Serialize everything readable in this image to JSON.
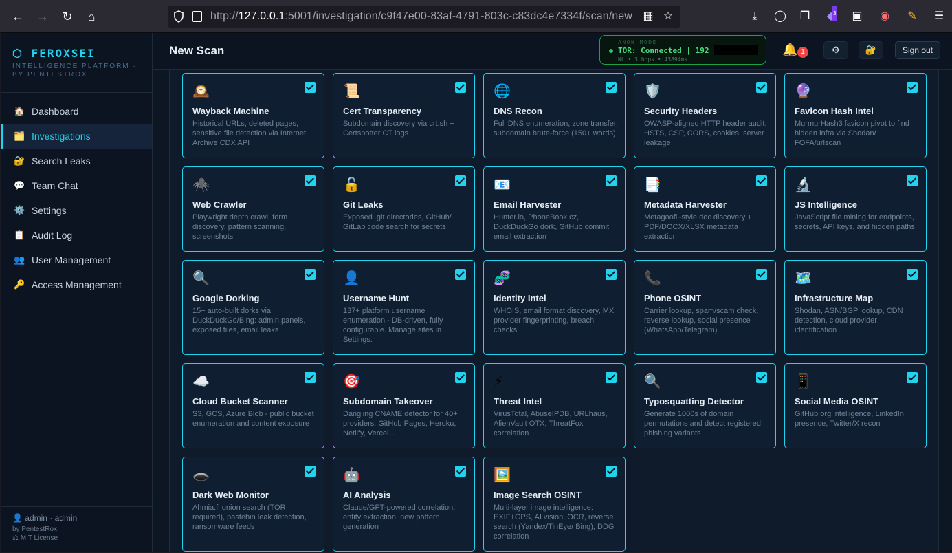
{
  "browser": {
    "url_prefix": "http://",
    "url_host": "127.0.0.1",
    "url_rest": ":5001/investigation/c9f47e00-83af-4791-803c-c83dc4e7334f/scan/new",
    "ext_badge": "3"
  },
  "sidebar": {
    "brand": "⬡ FEROXSEI",
    "brand_sub": "INTELLIGENCE PLATFORM · BY PENTESTROX",
    "items": [
      {
        "label": "Dashboard",
        "icon": "🏠"
      },
      {
        "label": "Investigations",
        "icon": "🗂️"
      },
      {
        "label": "Search Leaks",
        "icon": "🔐"
      },
      {
        "label": "Team Chat",
        "icon": "💬"
      },
      {
        "label": "Settings",
        "icon": "⚙️"
      },
      {
        "label": "Audit Log",
        "icon": "📋"
      },
      {
        "label": "User Management",
        "icon": "👥"
      },
      {
        "label": "Access Management",
        "icon": "🔑"
      }
    ],
    "user": "👤 admin · admin",
    "by": "by PentestRox",
    "license": "⚖ MIT License"
  },
  "header": {
    "title": "New Scan",
    "anon_label": "ANON MODE",
    "tor_status": "TOR: Connected | 192",
    "tor_meta": "NL • 3 hops • 43894ms",
    "notif_count": "1",
    "signout": "Sign out"
  },
  "modules": [
    {
      "icon": "🕰️",
      "name": "Wayback Machine",
      "desc": "Historical URLs, deleted pages, sensitive file detection via Internet Archive CDX API"
    },
    {
      "icon": "📜",
      "name": "Cert Transparency",
      "desc": "Subdomain discovery via crt.sh + Certspotter CT logs"
    },
    {
      "icon": "🌐",
      "name": "DNS Recon",
      "desc": "Full DNS enumeration, zone transfer, subdomain brute-force (150+ words)"
    },
    {
      "icon": "🛡️",
      "name": "Security Headers",
      "desc": "OWASP-aligned HTTP header audit: HSTS, CSP, CORS, cookies, server leakage"
    },
    {
      "icon": "🔮",
      "name": "Favicon Hash Intel",
      "desc": "MurmurHash3 favicon pivot to find hidden infra via Shodan/ FOFA/urlscan"
    },
    {
      "icon": "🕷️",
      "name": "Web Crawler",
      "desc": "Playwright depth crawl, form discovery, pattern scanning, screenshots"
    },
    {
      "icon": "🔓",
      "name": "Git Leaks",
      "desc": "Exposed .git directories, GitHub/ GitLab code search for secrets"
    },
    {
      "icon": "📧",
      "name": "Email Harvester",
      "desc": "Hunter.io, PhoneBook.cz, DuckDuckGo dork, GitHub commit email extraction"
    },
    {
      "icon": "📑",
      "name": "Metadata Harvester",
      "desc": "Metagoofil-style doc discovery + PDF/DOCX/XLSX metadata extraction"
    },
    {
      "icon": "🔬",
      "name": "JS Intelligence",
      "desc": "JavaScript file mining for endpoints, secrets, API keys, and hidden paths"
    },
    {
      "icon": "🔍",
      "name": "Google Dorking",
      "desc": "15+ auto-built dorks via DuckDuckGo/Bing: admin panels, exposed files, email leaks"
    },
    {
      "icon": "👤",
      "name": "Username Hunt",
      "desc": "137+ platform username enumeration - DB-driven, fully configurable. Manage sites in Settings."
    },
    {
      "icon": "🧬",
      "name": "Identity Intel",
      "desc": "WHOIS, email format discovery, MX provider fingerprinting, breach checks"
    },
    {
      "icon": "📞",
      "name": "Phone OSINT",
      "desc": "Carrier lookup, spam/scam check, reverse lookup, social presence (WhatsApp/Telegram)"
    },
    {
      "icon": "🗺️",
      "name": "Infrastructure Map",
      "desc": "Shodan, ASN/BGP lookup, CDN detection, cloud provider identification"
    },
    {
      "icon": "☁️",
      "name": "Cloud Bucket Scanner",
      "desc": "S3, GCS, Azure Blob - public bucket enumeration and content exposure"
    },
    {
      "icon": "🎯",
      "name": "Subdomain Takeover",
      "desc": "Dangling CNAME detector for 40+ providers: GitHub Pages, Heroku, Netlify, Vercel..."
    },
    {
      "icon": "⚡",
      "name": "Threat Intel",
      "desc": "VirusTotal, AbuseIPDB, URLhaus, AlienVault OTX, ThreatFox correlation"
    },
    {
      "icon": "🔍",
      "name": "Typosquatting Detector",
      "desc": "Generate 1000s of domain permutations and detect registered phishing variants"
    },
    {
      "icon": "📱",
      "name": "Social Media OSINT",
      "desc": "GitHub org intelligence, LinkedIn presence, Twitter/X recon"
    },
    {
      "icon": "🕳️",
      "name": "Dark Web Monitor",
      "desc": "Ahmia.fi onion search (TOR required), pastebin leak detection, ransomware feeds"
    },
    {
      "icon": "🤖",
      "name": "AI Analysis",
      "desc": "Claude/GPT-powered correlation, entity extraction, new pattern generation"
    },
    {
      "icon": "🖼️",
      "name": "Image Search OSINT",
      "desc": "Multi-layer image intelligence: EXIF+GPS, AI vision, OCR, reverse search (Yandex/TinEye/ Bing), DDG correlation"
    }
  ]
}
